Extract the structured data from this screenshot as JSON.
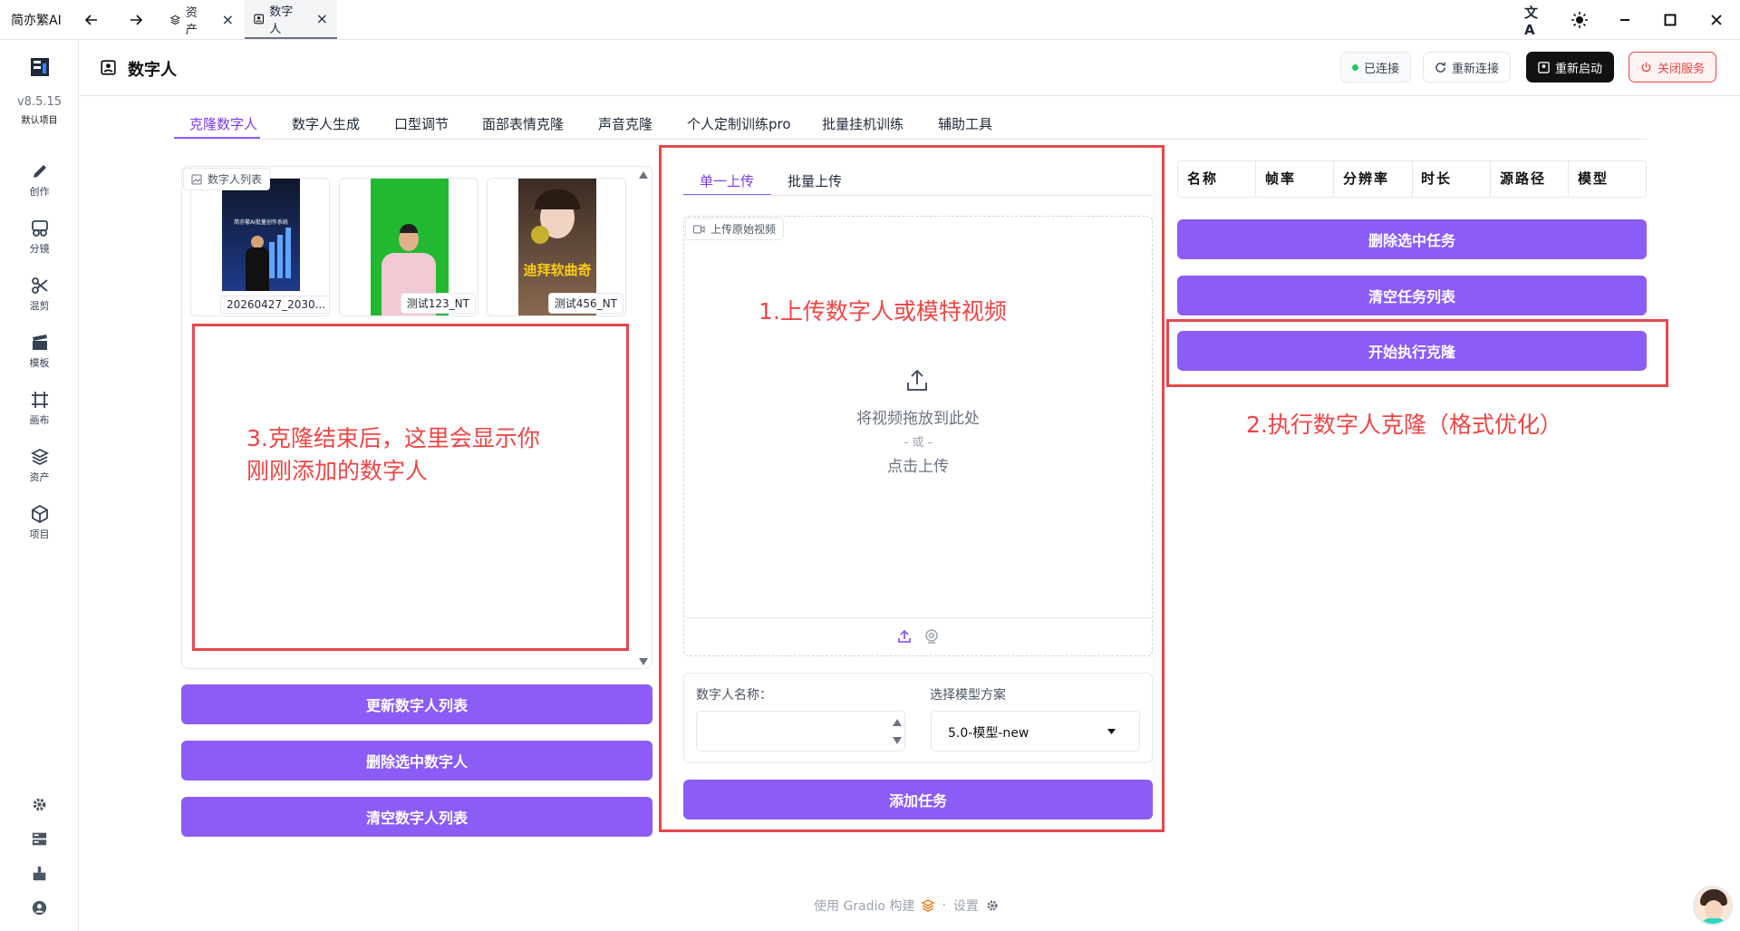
{
  "titlebar": {
    "app_name": "简亦繁AI",
    "tabs": [
      {
        "label": "资产",
        "icon": "layers-icon"
      },
      {
        "label": "数字人",
        "icon": "portrait-icon"
      }
    ]
  },
  "sidebar": {
    "version": "v8.5.15",
    "project": "默认项目",
    "items": [
      {
        "label": "创作",
        "icon": "pencil-icon"
      },
      {
        "label": "分镜",
        "icon": "storyboard-icon"
      },
      {
        "label": "混剪",
        "icon": "scissors-icon"
      },
      {
        "label": "模板",
        "icon": "clapper-icon"
      },
      {
        "label": "画布",
        "icon": "frame-icon"
      },
      {
        "label": "资产",
        "icon": "layers-icon"
      },
      {
        "label": "项目",
        "icon": "cube-icon"
      }
    ],
    "bottom_icons": [
      "gear-icon",
      "server-icon",
      "broom-icon",
      "user-icon"
    ]
  },
  "header": {
    "title": "数字人",
    "status": "已连接",
    "reconnect": "重新连接",
    "restart": "重新启动",
    "shutdown": "关闭服务"
  },
  "tabs": [
    "克隆数字人",
    "数字人生成",
    "口型调节",
    "面部表情克隆",
    "声音克隆",
    "个人定制训练pro",
    "批量挂机训练",
    "辅助工具"
  ],
  "active_tab": 0,
  "gallery": {
    "label": "数字人列表",
    "items": [
      {
        "caption": "20260427_2030...",
        "poster_text": "简亦繁AI批量创作系统"
      },
      {
        "caption": "测试123_NT"
      },
      {
        "caption": "测试456_NT",
        "poster_text": "迪拜软曲奇"
      }
    ]
  },
  "left_buttons": {
    "refresh": "更新数字人列表",
    "delete": "删除选中数字人",
    "clear": "清空数字人列表"
  },
  "upload": {
    "tabs": [
      "单一上传",
      "批量上传"
    ],
    "label": "上传原始视频",
    "drop_text": "将视频拖放到此处",
    "or_text": "- 或 -",
    "click_text": "点击上传",
    "name_label": "数字人名称：",
    "name_value": "",
    "model_label": "选择模型方案",
    "model_value": "5.0-模型-new",
    "add_task": "添加任务"
  },
  "task_table": {
    "headers": [
      "名称",
      "帧率",
      "分辨率",
      "时长",
      "源路径",
      "模型"
    ]
  },
  "right_buttons": {
    "delete_selected": "删除选中任务",
    "clear_list": "清空任务列表",
    "start_clone": "开始执行克隆"
  },
  "annotations": {
    "step1": "1.上传数字人或模特视频",
    "step2": "2.执行数字人克隆（格式优化）",
    "step3_line1": "3.克隆结束后，这里会显示你",
    "step3_line2": "刚刚添加的数字人"
  },
  "footer": {
    "built_with": "使用 Gradio 构建",
    "settings": "设置"
  },
  "colors": {
    "accent": "#8b5cf6",
    "annotation_red": "#ef4444",
    "status_green": "#22c55e"
  }
}
